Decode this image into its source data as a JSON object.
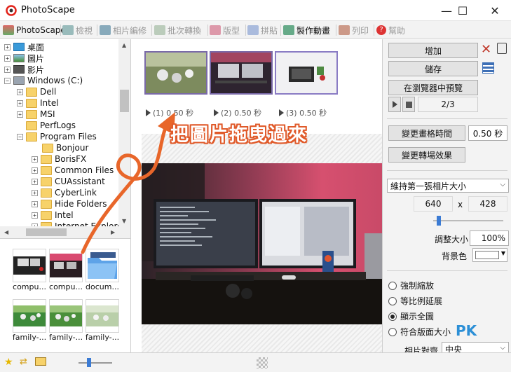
{
  "window": {
    "title": "PhotoScape",
    "minimize": "—",
    "maximize": "☐",
    "close": "✕"
  },
  "tabs": [
    {
      "label": "PhotoScape",
      "active": true,
      "icon": "photoscape-icon"
    },
    {
      "label": "檢視",
      "active": false,
      "icon": "viewer-icon"
    },
    {
      "label": "相片編修",
      "active": false,
      "icon": "editor-icon"
    },
    {
      "label": "批次轉換",
      "active": false,
      "icon": "batch-icon"
    },
    {
      "label": "版型",
      "active": false,
      "icon": "page-icon"
    },
    {
      "label": "拼貼",
      "active": false,
      "icon": "combine-icon"
    },
    {
      "label": "製作動畫",
      "active": true,
      "icon": "animated-gif-icon"
    },
    {
      "label": "列印",
      "active": false,
      "icon": "print-icon"
    },
    {
      "label": "幫助",
      "active": false,
      "icon": "help-icon"
    }
  ],
  "tree": {
    "desktop": "桌面",
    "pictures": "圖片",
    "videos": "影片",
    "drive": "Windows (C:)",
    "folders": [
      "Dell",
      "Intel",
      "MSI",
      "PerfLogs",
      "Program Files"
    ],
    "program_files": [
      "Bonjour",
      "BorisFX",
      "Common Files",
      "CUAssistant",
      "CyberLink",
      "Hide Folders",
      "Intel",
      "Internet Explorer"
    ]
  },
  "thumbnails": [
    {
      "label": "compu...",
      "kind": "computer"
    },
    {
      "label": "compu...",
      "kind": "computer-pink"
    },
    {
      "label": "docum...",
      "kind": "folder"
    },
    {
      "label": "family-...",
      "kind": "family"
    },
    {
      "label": "family-...",
      "kind": "family"
    },
    {
      "label": "family-...",
      "kind": "family-light"
    }
  ],
  "frames": [
    {
      "label": "(1) 0.50 秒"
    },
    {
      "label": "(2) 0.50 秒"
    },
    {
      "label": "(3) 0.50 秒"
    }
  ],
  "overlay_text": "把圖片拖曳過來",
  "right_panel": {
    "add": "增加",
    "save": "儲存",
    "preview_browser": "在瀏覽器中預覽",
    "frame_counter": "2/3",
    "change_time": "變更畫格時間",
    "time_value": "0.50 秒",
    "change_effect": "變更轉場效果",
    "size_mode": "維持第一張相片大小",
    "width": "640",
    "x": "x",
    "height": "428",
    "resize_label": "調整大小",
    "resize_value": "100%",
    "bg_label": "背景色",
    "radios": [
      {
        "label": "強制縮放",
        "checked": false
      },
      {
        "label": "等比例延展",
        "checked": false
      },
      {
        "label": "顯示全圖",
        "checked": true
      },
      {
        "label": "符合版面大小",
        "checked": false
      }
    ],
    "align_label": "相片對齊",
    "align_value": "中央"
  },
  "watermark": "PK"
}
